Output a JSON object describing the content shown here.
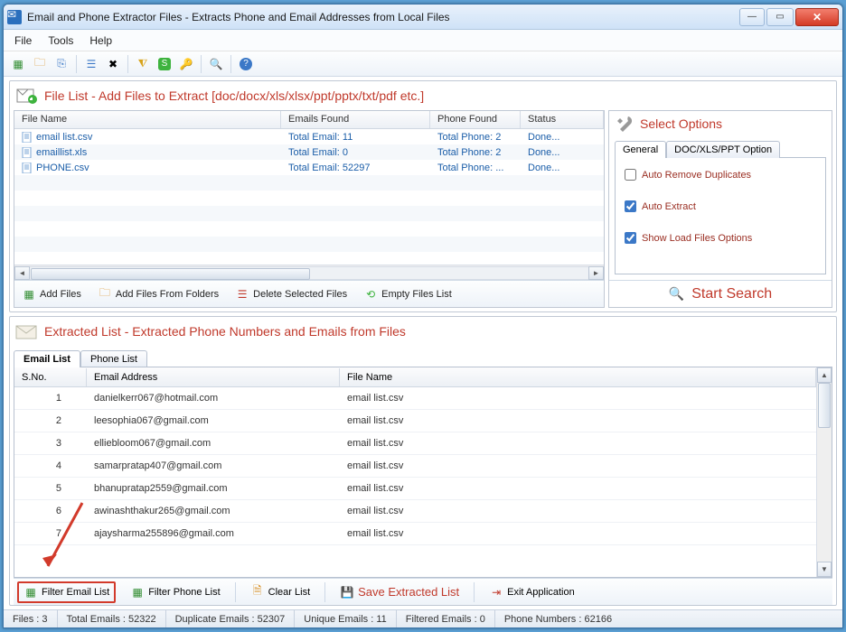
{
  "window": {
    "title": "Email and Phone Extractor Files  -  Extracts Phone and Email Addresses from Local Files"
  },
  "menu": {
    "file": "File",
    "tools": "Tools",
    "help": "Help"
  },
  "file_panel": {
    "title": "File List - Add Files to Extract  [doc/docx/xls/xlsx/ppt/pptx/txt/pdf etc.]",
    "columns": {
      "name": "File Name",
      "emails": "Emails Found",
      "phone": "Phone Found",
      "status": "Status"
    },
    "rows": [
      {
        "name": "email list.csv",
        "emails": "Total Email: 11",
        "phone": "Total Phone: 2",
        "status": "Done..."
      },
      {
        "name": "emaillist.xls",
        "emails": "Total Email: 0",
        "phone": "Total Phone: 2",
        "status": "Done..."
      },
      {
        "name": "PHONE.csv",
        "emails": "Total Email: 52297",
        "phone": "Total Phone: ...",
        "status": "Done..."
      }
    ],
    "buttons": {
      "add_files": "Add Files",
      "add_folders": "Add Files From Folders",
      "delete": "Delete Selected Files",
      "empty": "Empty Files List"
    }
  },
  "options": {
    "title": "Select Options",
    "tab_general": "General",
    "tab_doc": "DOC/XLS/PPT Option",
    "auto_remove": "Auto Remove Duplicates",
    "auto_extract": "Auto Extract",
    "show_load": "Show Load Files Options",
    "start": "Start Search"
  },
  "extracted": {
    "title": "Extracted List - Extracted Phone Numbers and Emails from Files",
    "tab_email": "Email List",
    "tab_phone": "Phone List",
    "columns": {
      "sno": "S.No.",
      "email": "Email Address",
      "file": "File Name"
    },
    "rows": [
      {
        "sno": "1",
        "email": "danielkerr067@hotmail.com",
        "file": "email list.csv"
      },
      {
        "sno": "2",
        "email": "leesophia067@gmail.com",
        "file": "email list.csv"
      },
      {
        "sno": "3",
        "email": "elliebloom067@gmail.com",
        "file": "email list.csv"
      },
      {
        "sno": "4",
        "email": "samarpratap407@gmail.com",
        "file": "email list.csv"
      },
      {
        "sno": "5",
        "email": "bhanupratap2559@gmail.com",
        "file": "email list.csv"
      },
      {
        "sno": "6",
        "email": "awinashthakur265@gmail.com",
        "file": "email list.csv"
      },
      {
        "sno": "7",
        "email": "ajaysharma255896@gmail.com",
        "file": "email list.csv"
      }
    ],
    "buttons": {
      "filter_email": "Filter Email List",
      "filter_phone": "Filter Phone List",
      "clear": "Clear List",
      "save": "Save Extracted List",
      "exit": "Exit Application"
    }
  },
  "status": {
    "files": "Files :  3",
    "total": "Total Emails :  52322",
    "dup": "Duplicate Emails :  52307",
    "unique": "Unique Emails :  11",
    "filtered": "Filtered Emails :  0",
    "phone": "Phone Numbers :  62166"
  }
}
